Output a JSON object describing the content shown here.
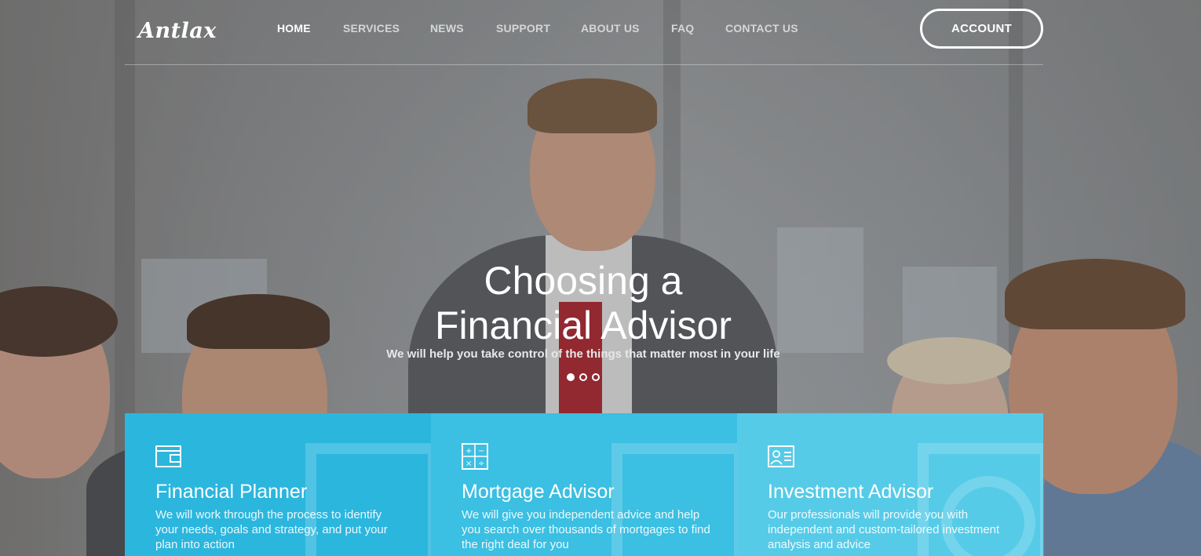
{
  "header": {
    "logo": "Antlax",
    "nav": [
      {
        "label": "HOME",
        "active": true
      },
      {
        "label": "SERVICES",
        "active": false
      },
      {
        "label": "NEWS",
        "active": false
      },
      {
        "label": "SUPPORT",
        "active": false
      },
      {
        "label": "ABOUT US",
        "active": false
      },
      {
        "label": "FAQ",
        "active": false
      },
      {
        "label": "CONTACT US",
        "active": false
      }
    ],
    "account_label": "ACCOUNT"
  },
  "hero": {
    "title_line1": "Choosing a",
    "title_line2": "Financial Advisor",
    "subtitle": "We will help you take control of the things that matter most in your life",
    "slides": 3,
    "active_slide": 1
  },
  "services": [
    {
      "icon": "wallet-icon",
      "title": "Financial Planner",
      "text": "We will work through the process to identify your needs, goals and strategy, and put your plan into action",
      "color": "#2bb6de"
    },
    {
      "icon": "calculator-icon",
      "title": "Mortgage Advisor",
      "text": "We will give you independent advice and help you search over thousands of mortgages to find the right deal for you",
      "color": "#3bbfe2"
    },
    {
      "icon": "id-card-icon",
      "title": "Investment Advisor",
      "text": "Our professionals will provide you with independent and custom-tailored investment analysis and advice",
      "color": "#56cbe8"
    }
  ]
}
